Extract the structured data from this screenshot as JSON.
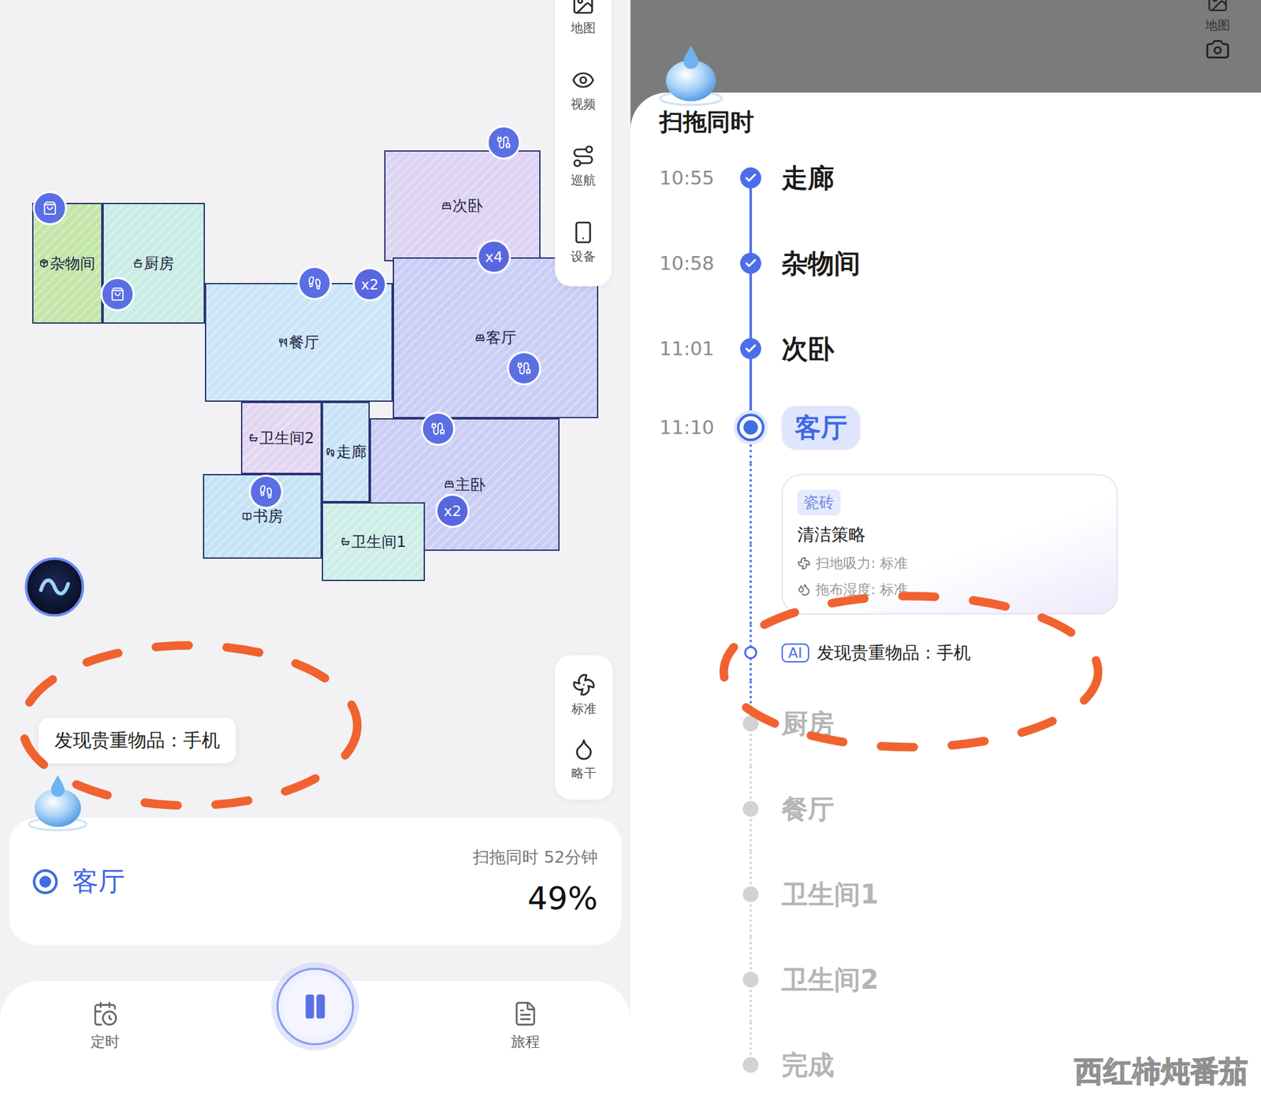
{
  "left": {
    "toolbar": [
      {
        "label": "地图"
      },
      {
        "label": "视频"
      },
      {
        "label": "巡航"
      },
      {
        "label": "设备"
      }
    ],
    "map": {
      "rooms": [
        {
          "name": "杂物间",
          "color": "#c2e5a8"
        },
        {
          "name": "厨房",
          "color": "#c9ece4"
        },
        {
          "name": "餐厅",
          "color": "#cbe5f8"
        },
        {
          "name": "次卧",
          "color": "#ddd3f3"
        },
        {
          "name": "客厅",
          "color": "#c8cef6"
        },
        {
          "name": "卫生间2",
          "color": "#e3d6f1"
        },
        {
          "name": "走廊",
          "color": "#c8e3f6"
        },
        {
          "name": "主卧",
          "color": "#cacdf4"
        },
        {
          "name": "书房",
          "color": "#c6e3f6"
        },
        {
          "name": "卫生间1",
          "color": "#cdeee6"
        }
      ],
      "badges": [
        {
          "label": "x2"
        },
        {
          "label": "x4"
        },
        {
          "label": "x2"
        }
      ]
    },
    "modes": [
      {
        "label": "标准"
      },
      {
        "label": "略干"
      }
    ],
    "alert": {
      "text": "发现贵重物品：手机"
    },
    "progress": {
      "room": "客厅",
      "summary": "扫拖同时 52分钟",
      "percent": "49%"
    },
    "controls": {
      "running": true,
      "items": [
        {
          "label": "定时"
        },
        {
          "label": "旅程"
        }
      ]
    }
  },
  "right": {
    "toolbar": [
      {
        "label": "地图"
      }
    ],
    "title": "扫拖同时",
    "steps": [
      {
        "time": "10:55",
        "room": "走廊",
        "status": "done"
      },
      {
        "time": "10:58",
        "room": "杂物间",
        "status": "done"
      },
      {
        "time": "11:01",
        "room": "次卧",
        "status": "done"
      },
      {
        "time": "11:10",
        "room": "客厅",
        "status": "current"
      },
      {
        "room": "厨房",
        "status": "pending"
      },
      {
        "room": "餐厅",
        "status": "pending"
      },
      {
        "room": "卫生间1",
        "status": "pending"
      },
      {
        "room": "卫生间2",
        "status": "pending"
      },
      {
        "room": "完成",
        "status": "pending"
      }
    ],
    "detail": {
      "floor": "瓷砖",
      "heading": "清洁策略",
      "settings": [
        {
          "label": "扫地吸力: 标准"
        },
        {
          "label": "拖布湿度: 标准"
        }
      ]
    },
    "ai_alert": {
      "badge": "AI",
      "text": "发现贵重物品：手机"
    },
    "watermark": "西红柿炖番茄"
  }
}
